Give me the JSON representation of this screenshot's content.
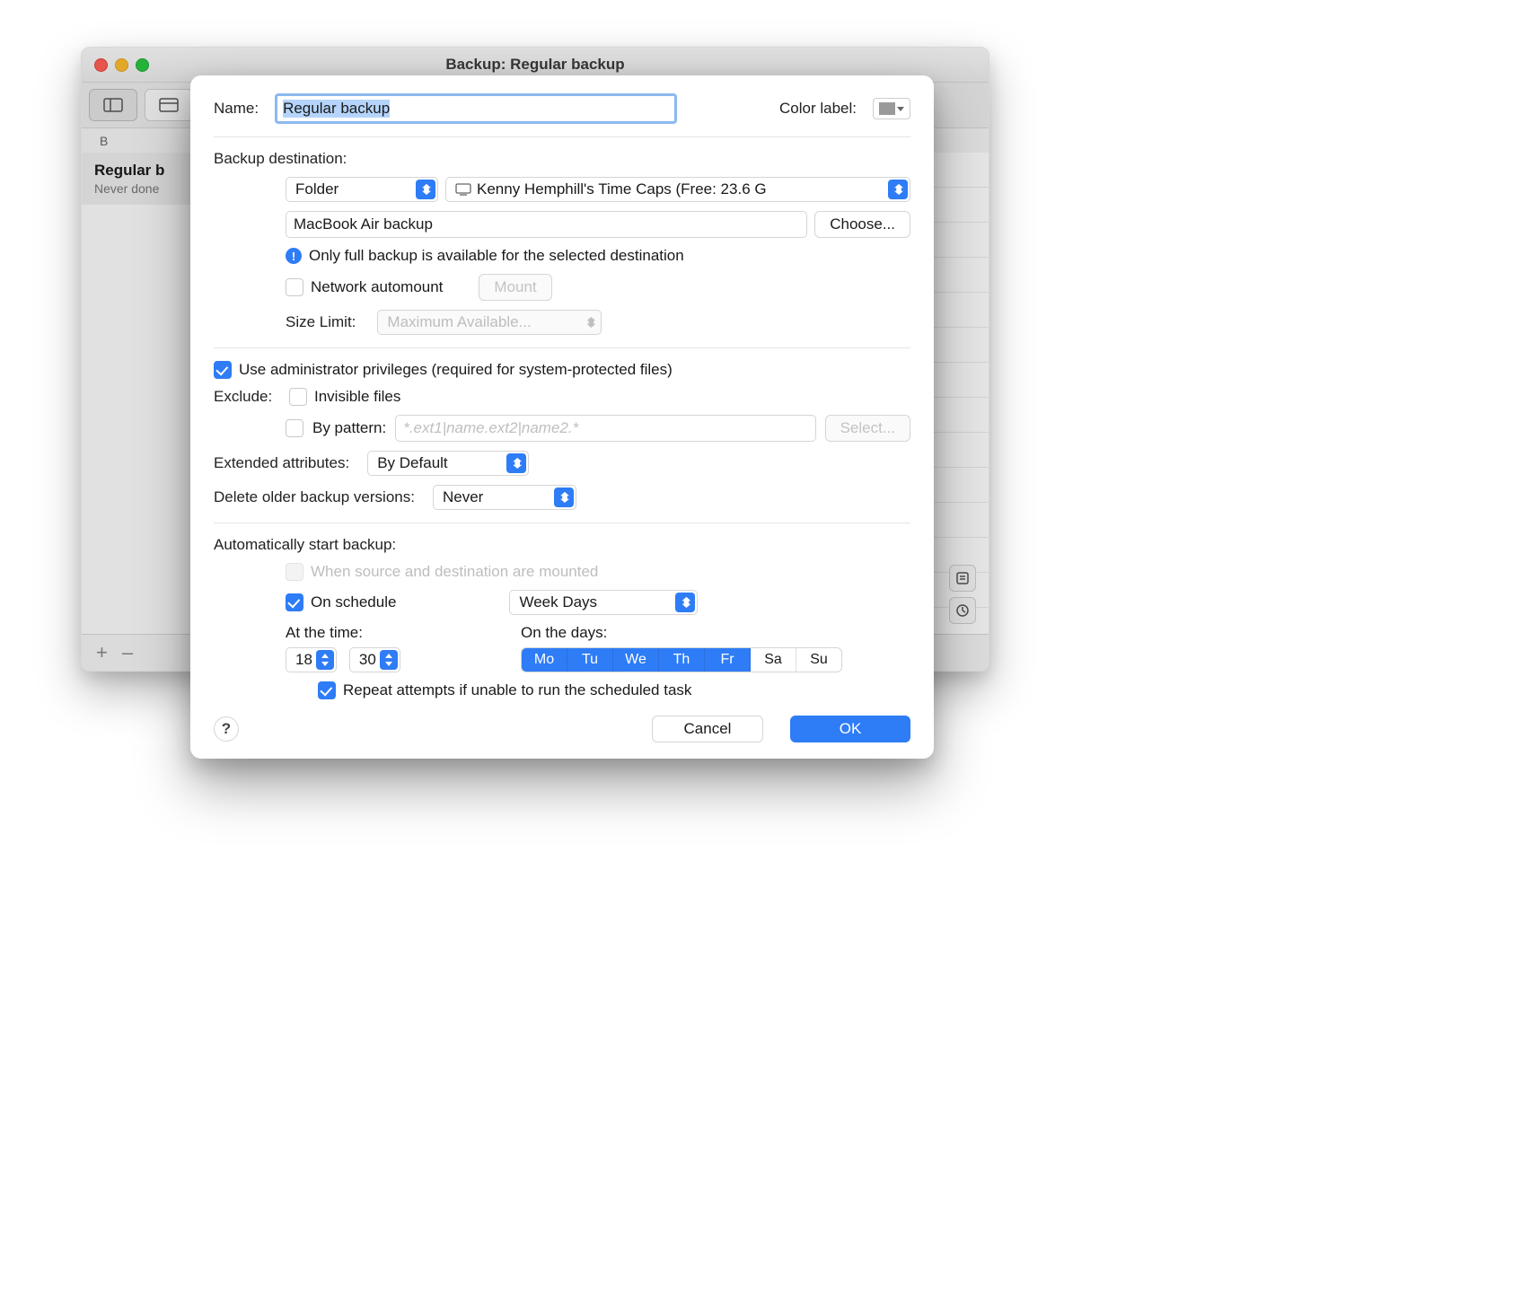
{
  "window": {
    "title": "Backup: Regular backup"
  },
  "sidebar": {
    "header_initial": "B",
    "item": {
      "name": "Regular b",
      "subtitle": "Never done"
    }
  },
  "footer": {
    "add": "+",
    "remove": "–"
  },
  "modal": {
    "name_label": "Name:",
    "name_value": "Regular backup",
    "color_label": "Color label:",
    "dest_label": "Backup destination:",
    "dest_type": "Folder",
    "dest_volume": "Kenny Hemphill's Time Caps (Free: 23.6 G",
    "dest_path": "MacBook Air backup",
    "choose_btn": "Choose...",
    "dest_note": "Only full backup is available for the selected destination",
    "net_automount": "Network automount",
    "mount_btn": "Mount",
    "size_label": "Size Limit:",
    "size_value": "Maximum Available...",
    "admin_label": "Use administrator privileges (required for system-protected files)",
    "exclude_label": "Exclude:",
    "exclude_invisible": "Invisible files",
    "exclude_pattern_label": "By pattern:",
    "exclude_pattern_placeholder": "*.ext1|name.ext2|name2.*",
    "select_btn": "Select...",
    "extattr_label": "Extended attributes:",
    "extattr_value": "By Default",
    "delete_label": "Delete older backup versions:",
    "delete_value": "Never",
    "auto_label": "Automatically start backup:",
    "auto_mounted": "When source and destination are mounted",
    "auto_schedule": "On schedule",
    "schedule_value": "Week Days",
    "at_time_label": "At the time:",
    "time_h": "18",
    "time_m": "30",
    "on_days_label": "On the days:",
    "days": [
      "Mo",
      "Tu",
      "We",
      "Th",
      "Fr",
      "Sa",
      "Su"
    ],
    "days_selected": [
      true,
      true,
      true,
      true,
      true,
      false,
      false
    ],
    "repeat_label": "Repeat attempts if unable to run the scheduled task",
    "help": "?",
    "cancel": "Cancel",
    "ok": "OK"
  }
}
